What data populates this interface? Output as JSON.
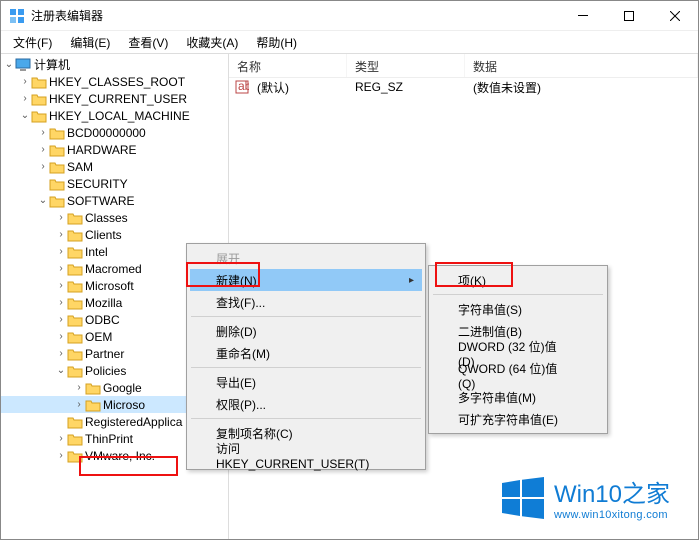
{
  "window": {
    "title": "注册表编辑器"
  },
  "menu": {
    "file": "文件(F)",
    "edit": "编辑(E)",
    "view": "查看(V)",
    "fav": "收藏夹(A)",
    "help": "帮助(H)"
  },
  "tree": {
    "root": "计算机",
    "hkcr": "HKEY_CLASSES_ROOT",
    "hkcu": "HKEY_CURRENT_USER",
    "hklm": "HKEY_LOCAL_MACHINE",
    "bcd": "BCD00000000",
    "hw": "HARDWARE",
    "sam": "SAM",
    "sec": "SECURITY",
    "sw": "SOFTWARE",
    "classes": "Classes",
    "clients": "Clients",
    "intel": "Intel",
    "macromed": "Macromed",
    "microsoft": "Microsoft",
    "mozilla": "Mozilla",
    "odbc": "ODBC",
    "oem": "OEM",
    "partner": "Partner",
    "policies": "Policies",
    "google": "Google",
    "microso": "Microso",
    "regapp": "RegisteredApplica",
    "thinprint": "ThinPrint",
    "vmware": "VMware, Inc."
  },
  "list": {
    "hdr_name": "名称",
    "hdr_type": "类型",
    "hdr_data": "数据",
    "row_name": "(默认)",
    "row_type": "REG_SZ",
    "row_data": "(数值未设置)"
  },
  "ctx1": {
    "expand": "展开",
    "new": "新建(N)",
    "find": "查找(F)...",
    "del": "删除(D)",
    "rename": "重命名(M)",
    "export": "导出(E)",
    "perm": "权限(P)...",
    "copyname": "复制项名称(C)",
    "goto": "访问 HKEY_CURRENT_USER(T)"
  },
  "ctx2": {
    "key": "项(K)",
    "string": "字符串值(S)",
    "binary": "二进制值(B)",
    "dword": "DWORD (32 位)值(D)",
    "qword": "QWORD (64 位)值(Q)",
    "multi": "多字符串值(M)",
    "expand": "可扩充字符串值(E)"
  },
  "watermark": {
    "title": "Win10之家",
    "url": "www.win10xitong.com"
  }
}
